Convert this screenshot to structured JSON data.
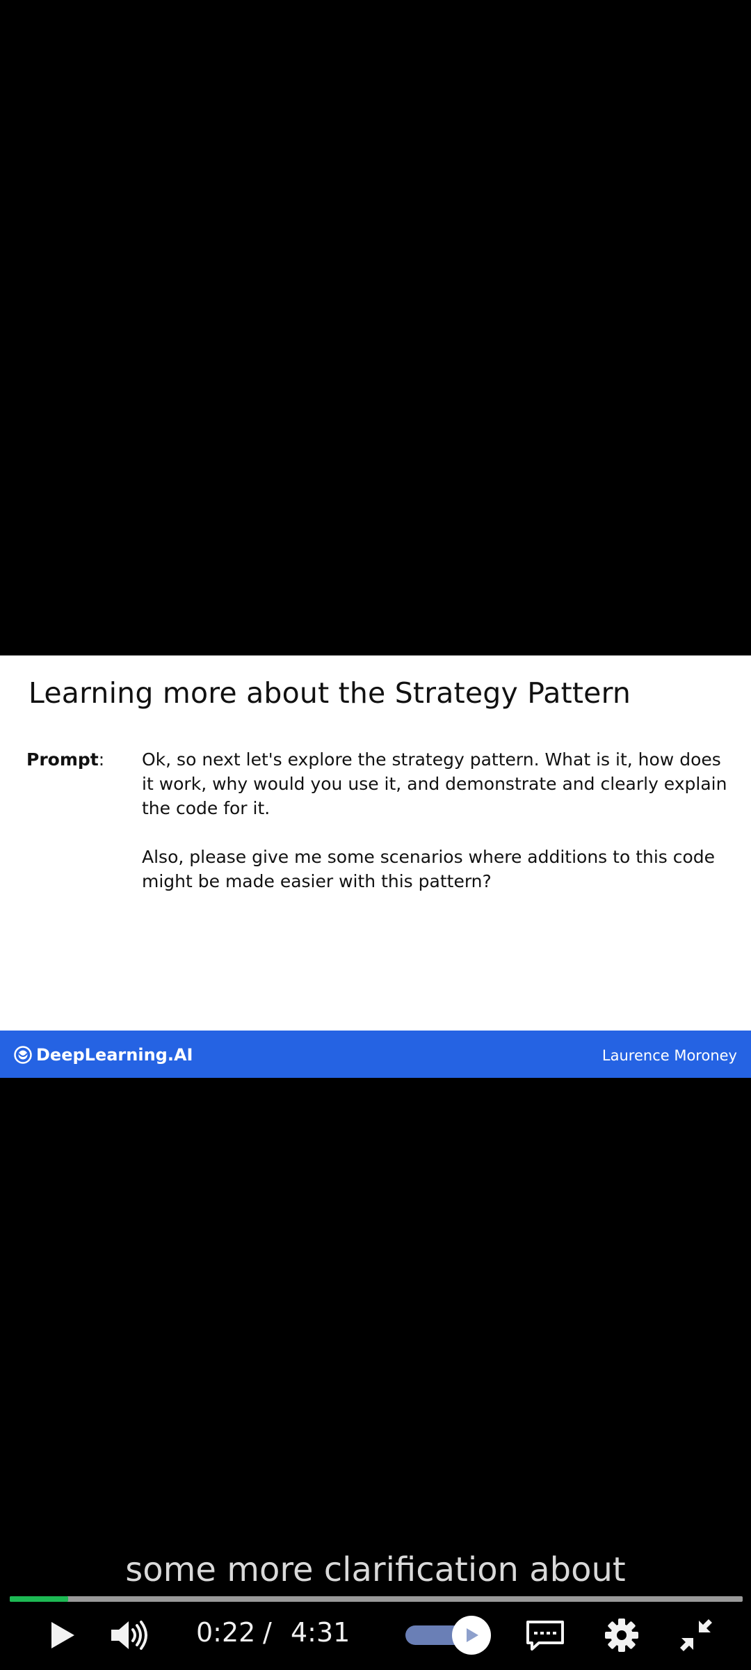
{
  "slide": {
    "title": "Learning more about the Strategy Pattern",
    "prompt_label": "Prompt",
    "prompt_colon": ":",
    "paragraph1": "Ok, so next let's explore the strategy pattern. What is it, how does it work, why would you use it, and demonstrate and clearly explain the code for it.",
    "paragraph2": "Also, please give me some scenarios where additions to this code might be made easier with this pattern?",
    "brand": "DeepLearning.AI",
    "presenter": "Laurence Moroney",
    "footer_color": "#2563e3"
  },
  "caption": "some more clarification about",
  "player": {
    "progress_fraction": 0.08,
    "progress_color": "#1db954",
    "current_time": "0:22",
    "separator": "/",
    "duration": "4:31",
    "icons": {
      "play": "play-icon",
      "volume": "volume-icon",
      "playback": "playback-toggle-icon",
      "captions": "captions-icon",
      "settings": "gear-icon",
      "exit_fullscreen": "exit-fullscreen-icon"
    }
  }
}
